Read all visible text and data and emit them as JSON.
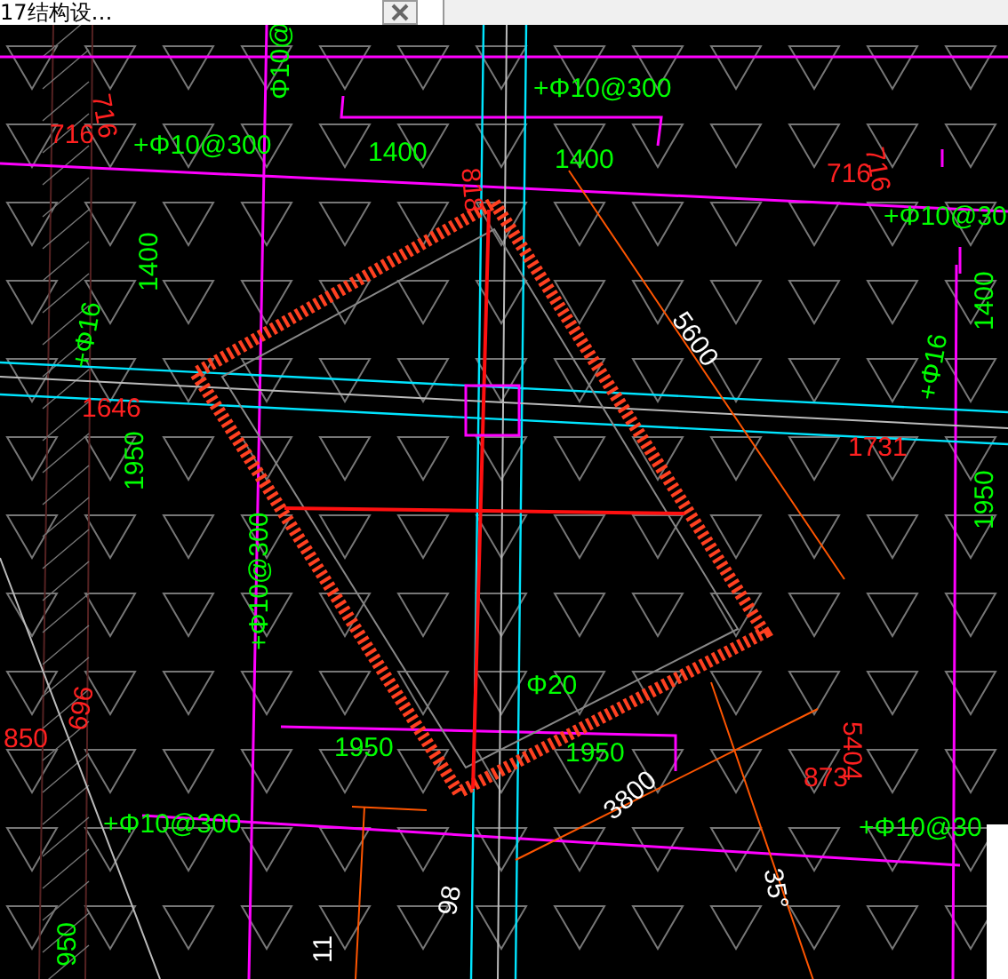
{
  "tab": {
    "title": "17结构设…",
    "selected": true
  },
  "annotations": [
    {
      "text": "Φ10@",
      "kind": "rebar"
    },
    {
      "text": "+Φ10@300",
      "kind": "rebar"
    },
    {
      "text": "1400",
      "kind": "rebar"
    },
    {
      "text": "1400",
      "kind": "rebar"
    },
    {
      "text": "716",
      "kind": "dimension"
    },
    {
      "text": "716",
      "kind": "dimension"
    },
    {
      "text": "+Φ10@300",
      "kind": "rebar"
    },
    {
      "text": "716",
      "kind": "dimension"
    },
    {
      "text": "716",
      "kind": "dimension"
    },
    {
      "text": "+Φ10@30",
      "kind": "rebar"
    },
    {
      "text": "818",
      "kind": "dimension"
    },
    {
      "text": "1400",
      "kind": "rebar"
    },
    {
      "text": "+Φ16",
      "kind": "rebar"
    },
    {
      "text": "1646",
      "kind": "dimension"
    },
    {
      "text": "1950",
      "kind": "rebar"
    },
    {
      "text": "5600",
      "kind": "measure"
    },
    {
      "text": "1400",
      "kind": "rebar"
    },
    {
      "text": "+Φ16",
      "kind": "rebar"
    },
    {
      "text": "1731",
      "kind": "dimension"
    },
    {
      "text": "1950",
      "kind": "rebar"
    },
    {
      "text": "+Φ10@300",
      "kind": "rebar"
    },
    {
      "text": "Φ20",
      "kind": "rebar"
    },
    {
      "text": "850",
      "kind": "dimension"
    },
    {
      "text": "696",
      "kind": "dimension"
    },
    {
      "text": "1950",
      "kind": "rebar"
    },
    {
      "text": "1950",
      "kind": "rebar"
    },
    {
      "text": "5404",
      "kind": "dimension"
    },
    {
      "text": "873",
      "kind": "dimension"
    },
    {
      "text": "3800",
      "kind": "measure"
    },
    {
      "text": "+Φ10@300",
      "kind": "rebar"
    },
    {
      "text": "+Φ10@30",
      "kind": "rebar"
    },
    {
      "text": "35°",
      "kind": "measure"
    },
    {
      "text": "98",
      "kind": "measure"
    },
    {
      "text": "11",
      "kind": "measure"
    },
    {
      "text": "950",
      "kind": "rebar"
    }
  ]
}
